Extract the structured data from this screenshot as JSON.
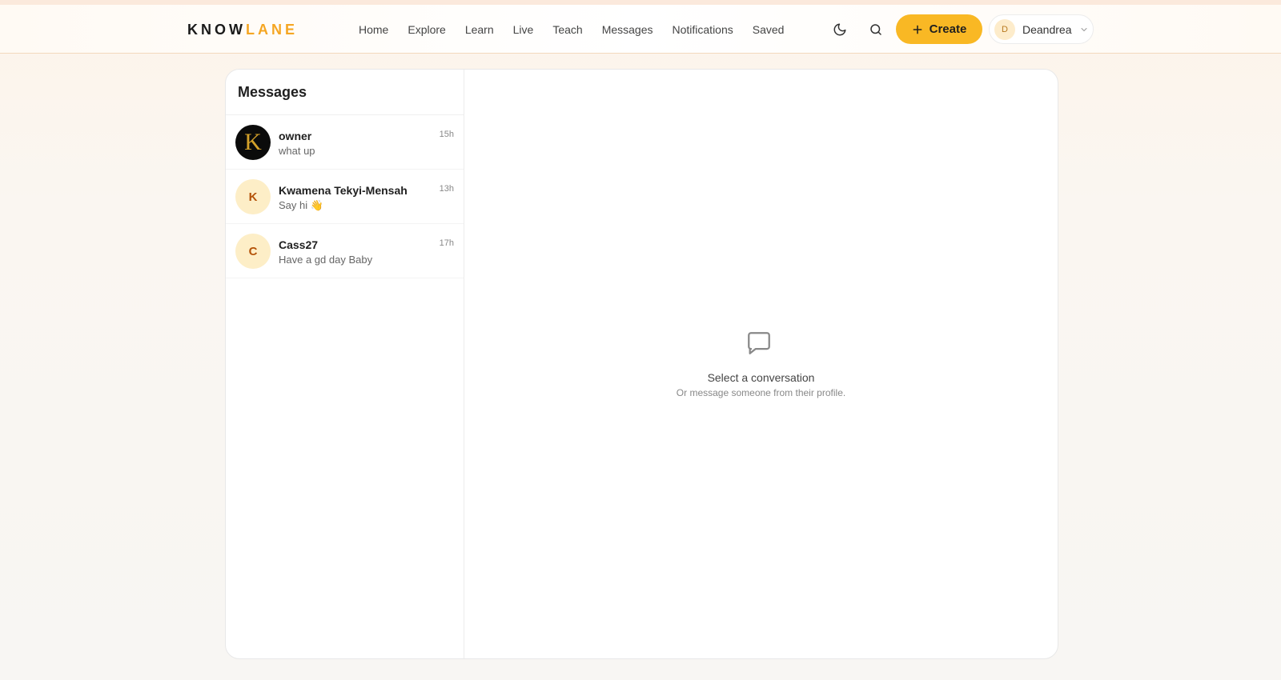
{
  "brand": {
    "part1": "KNOW",
    "part2": "LANE",
    "accent": "#f5a623"
  },
  "nav": [
    "Home",
    "Explore",
    "Learn",
    "Live",
    "Teach",
    "Messages",
    "Notifications",
    "Saved"
  ],
  "actions": {
    "theme_icon": "moon-icon",
    "search_icon": "search-icon",
    "create_label": "Create"
  },
  "user": {
    "initial": "D",
    "name": "Deandrea"
  },
  "sidebar": {
    "title": "Messages",
    "conversations": [
      {
        "avatar": "K",
        "name": "owner",
        "preview": "what up",
        "time": "15h"
      },
      {
        "avatar": "K",
        "name": "Kwamena Tekyi-Mensah",
        "preview": "Say hi 👋",
        "time": "13h"
      },
      {
        "avatar": "C",
        "name": "Cass27",
        "preview": "Have a gd day Baby",
        "time": "17h"
      }
    ]
  },
  "empty_state": {
    "icon": "chat-bubble-icon",
    "title": "Select a conversation",
    "subtitle": "Or message someone from their profile."
  }
}
